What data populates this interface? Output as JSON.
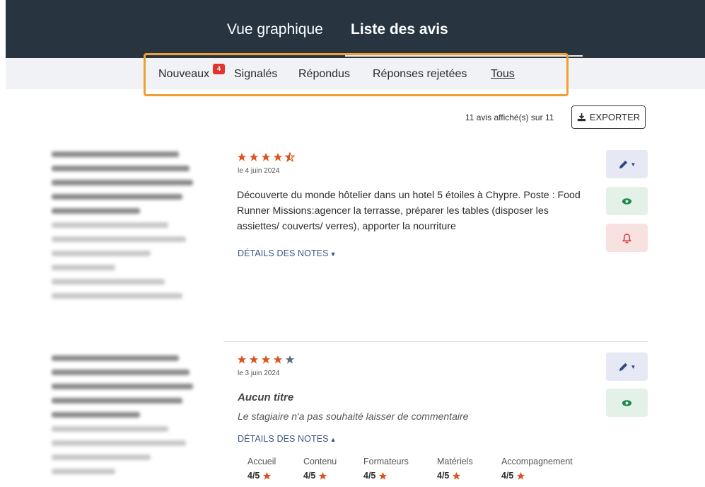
{
  "header": {
    "tabs": [
      {
        "label": "Vue graphique",
        "active": false
      },
      {
        "label": "Liste des avis",
        "active": true
      }
    ]
  },
  "filters": {
    "items": [
      {
        "label": "Nouveaux",
        "badge": "4"
      },
      {
        "label": "Signalés"
      },
      {
        "label": "Répondus"
      },
      {
        "label": "Réponses rejetées"
      },
      {
        "label": "Tous",
        "active": true
      }
    ]
  },
  "toolbar": {
    "count_text": "11 avis affiché(s) sur 11",
    "export_label": "EXPORTER",
    "export_icon": "download-icon"
  },
  "reviews": [
    {
      "rating": 4.5,
      "date": "le 4 juin 2024",
      "text": "Découverte du monde hôtelier dans un hotel 5 étoiles à Chypre. Poste : Food Runner Missions:agencer la terrasse, préparer les tables (disposer les assiettes/ couverts/ verres), apporter la nourriture",
      "details_label": "DÉTAILS DES NOTES",
      "details_expanded": false,
      "actions": [
        "pencil-icon",
        "eye-icon",
        "bell-icon"
      ]
    },
    {
      "rating": 4,
      "date": "le 3 juin 2024",
      "title": "Aucun titre",
      "text": "Le stagiaire n'a pas souhaité laisser de commentaire",
      "details_label": "DÉTAILS DES NOTES",
      "details_expanded": true,
      "actions": [
        "pencil-icon",
        "eye-icon"
      ],
      "grades": [
        {
          "label": "Accueil",
          "value": "4/5"
        },
        {
          "label": "Contenu",
          "value": "4/5"
        },
        {
          "label": "Formateurs",
          "value": "4/5"
        },
        {
          "label": "Matériels",
          "value": "4/5"
        },
        {
          "label": "Accompagnement",
          "value": "4/5"
        }
      ]
    }
  ],
  "colors": {
    "header_bg": "#283541",
    "star": "#d9541e",
    "star_empty": "#5f6b7a",
    "highlight": "#f0a033",
    "badge": "#e2342d"
  }
}
